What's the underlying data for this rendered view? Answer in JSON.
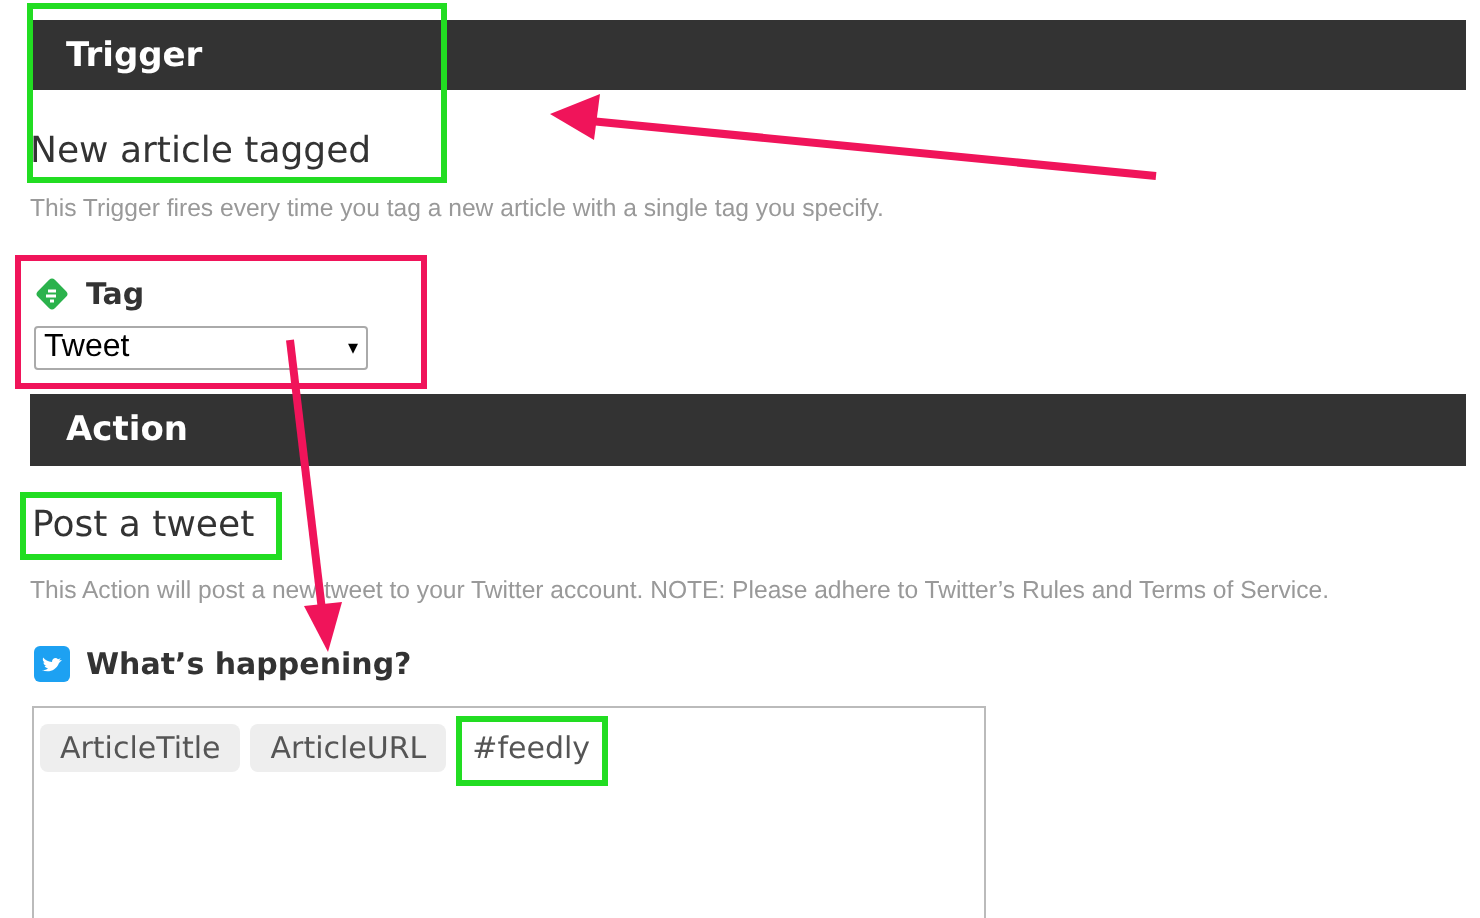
{
  "trigger": {
    "section_title": "Trigger",
    "name": "New article tagged",
    "description": "This Trigger fires every time you tag a new article with a single tag you specify.",
    "field": {
      "label": "Tag",
      "value": "Tweet",
      "caret": "▾"
    }
  },
  "action": {
    "section_title": "Action",
    "name": "Post a tweet",
    "description": "This Action will post a new tweet to your Twitter account. NOTE: Please adhere to Twitter’s Rules and Terms of Service.",
    "field": {
      "label": "What’s happening?",
      "parts": [
        {
          "kind": "token",
          "text": "ArticleTitle"
        },
        {
          "kind": "token",
          "text": "ArticleURL"
        },
        {
          "kind": "text",
          "text": "#feedly"
        }
      ]
    }
  }
}
